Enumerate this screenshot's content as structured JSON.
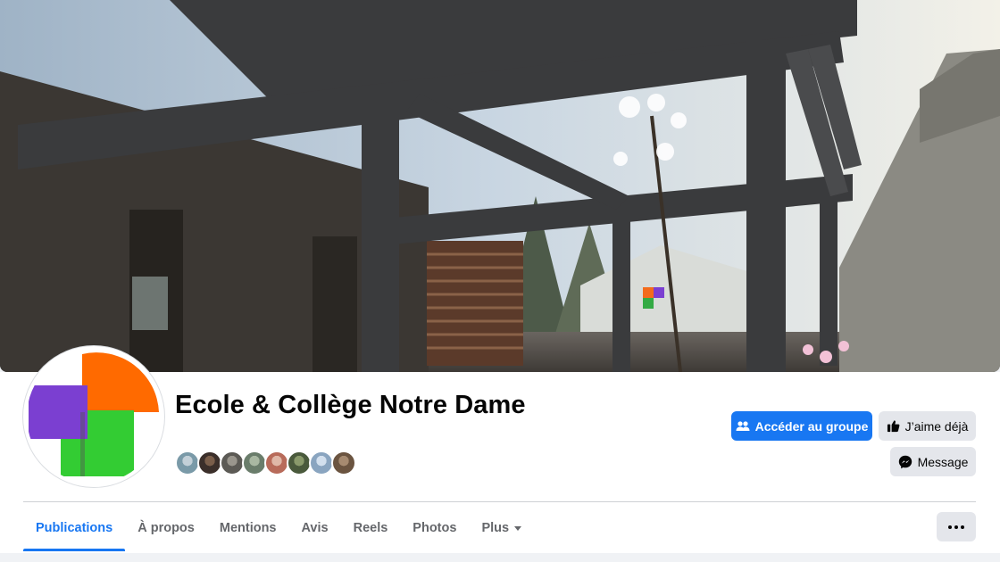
{
  "page": {
    "name": "Ecole & Collège Notre Dame"
  },
  "actions": {
    "primary_label": "Accéder au groupe",
    "like_label": "J’aime déjà",
    "message_label": "Message"
  },
  "tabs": [
    {
      "label": "Publications",
      "active": true
    },
    {
      "label": "À propos",
      "active": false
    },
    {
      "label": "Mentions",
      "active": false
    },
    {
      "label": "Avis",
      "active": false
    },
    {
      "label": "Reels",
      "active": false
    },
    {
      "label": "Photos",
      "active": false
    },
    {
      "label": "Plus",
      "active": false
    }
  ],
  "friends": {
    "colors": [
      "#7a9aa8",
      "#3b2f2a",
      "#5c5a55",
      "#6a7d6b",
      "#b86b5a",
      "#4a5a3c",
      "#8aa5c0",
      "#6b5440"
    ]
  },
  "colors": {
    "accent": "#1877f2",
    "logo_orange": "#ff6a00",
    "logo_purple": "#7b3fd1",
    "logo_green": "#33cc33"
  },
  "icons": {
    "primary": "group-icon",
    "like": "thumbs-up-icon",
    "message": "messenger-icon",
    "more": "ellipsis-icon",
    "plus_caret": "caret-down-icon"
  }
}
